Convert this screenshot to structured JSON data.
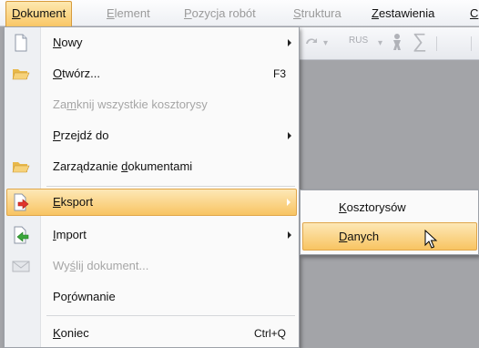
{
  "menubar": {
    "items": [
      {
        "label": "Dokument",
        "accel": "D",
        "rest": "okument",
        "state": "active"
      },
      {
        "label": "Element",
        "accel": "E",
        "rest": "lement",
        "state": "disabled"
      },
      {
        "label": "Pozycja robót",
        "accel": "P",
        "rest": "ozycja robót",
        "state": "disabled"
      },
      {
        "label": "Struktura",
        "accel": "S",
        "rest": "truktura",
        "state": "disabled"
      },
      {
        "label": "Zestawienia",
        "accel": "Z",
        "rest": "estawienia",
        "state": "normal"
      },
      {
        "label": "C",
        "accel": "C",
        "rest": "",
        "state": "normal"
      }
    ]
  },
  "toolbar": {
    "rus_label": "RUS"
  },
  "menu": {
    "items": [
      {
        "pre": "",
        "accel": "N",
        "post": "owy",
        "shortcut": "",
        "submenu": true,
        "icon": "new-document-icon",
        "disabled": false
      },
      {
        "pre": "",
        "accel": "O",
        "post": "twórz...",
        "shortcut": "F3",
        "submenu": false,
        "icon": "open-folder-icon",
        "disabled": false
      },
      {
        "pre": "Za",
        "accel": "m",
        "post": "knij wszystkie kosztorysy",
        "shortcut": "",
        "submenu": false,
        "icon": "",
        "disabled": true
      },
      {
        "pre": "",
        "accel": "P",
        "post": "rzejdź do",
        "shortcut": "",
        "submenu": true,
        "icon": "",
        "disabled": false
      },
      {
        "pre": "Zarządzanie ",
        "accel": "d",
        "post": "okumentami",
        "shortcut": "",
        "submenu": false,
        "icon": "folder-manage-icon",
        "disabled": false
      },
      {
        "pre": "",
        "accel": "E",
        "post": "ksport",
        "shortcut": "",
        "submenu": true,
        "icon": "export-icon",
        "disabled": false,
        "highlight": true
      },
      {
        "pre": "",
        "accel": "I",
        "post": "mport",
        "shortcut": "",
        "submenu": true,
        "icon": "import-icon",
        "disabled": false
      },
      {
        "pre": "Wy",
        "accel": "ś",
        "post": "lij dokument...",
        "shortcut": "",
        "submenu": false,
        "icon": "mail-icon",
        "disabled": true
      },
      {
        "pre": "Po",
        "accel": "r",
        "post": "ównanie",
        "shortcut": "",
        "submenu": false,
        "icon": "",
        "disabled": false
      },
      {
        "pre": "",
        "accel": "K",
        "post": "oniec",
        "shortcut": "Ctrl+Q",
        "submenu": false,
        "icon": "",
        "disabled": false
      }
    ]
  },
  "submenu": {
    "items": [
      {
        "pre": "",
        "accel": "K",
        "post": "osztorysów",
        "highlight": false
      },
      {
        "pre": "",
        "accel": "D",
        "post": "anych",
        "highlight": true
      }
    ]
  },
  "colors": {
    "highlight_top": "#fde8b6",
    "highlight_bottom": "#f8c462",
    "workspace": "#a3a4a8"
  }
}
